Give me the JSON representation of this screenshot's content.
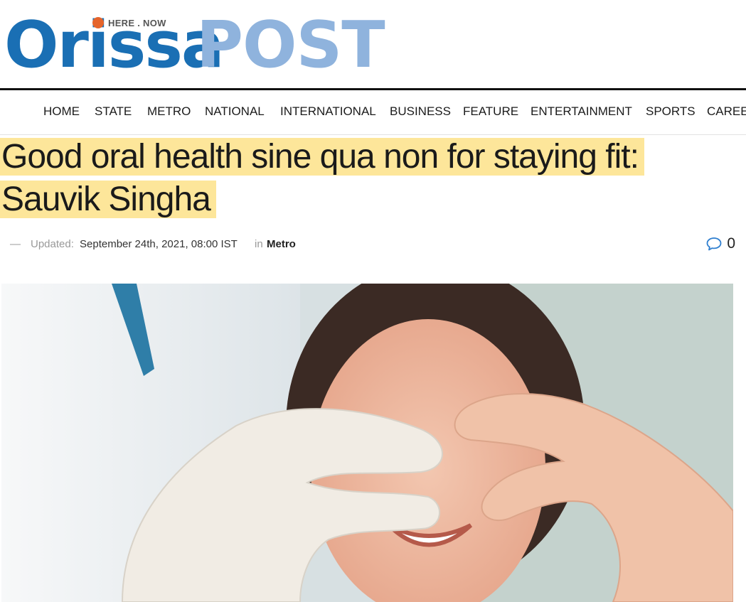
{
  "site": {
    "logo_word1": "Orissa",
    "logo_word2": "POST",
    "tagline": "HERE . NOW",
    "colors": {
      "logo_blue": "#1a6fb4",
      "logo_light_blue": "#8fb3dd",
      "logo_dot": "#e5642b",
      "highlight": "#fde69a"
    }
  },
  "nav": {
    "items": [
      "HOME",
      "STATE",
      "METRO",
      "NATIONAL",
      "INTERNATIONAL",
      "BUSINESS",
      "FEATURE",
      "ENTERTAINMENT",
      "SPORTS",
      "CAREE"
    ]
  },
  "article": {
    "title_line1": "Good oral health sine qua non for staying fit:",
    "title_line2": "Sauvik Singha",
    "meta": {
      "dash": "—",
      "updated_label": "Updated:",
      "date": "September 24th, 2021, 08:00 IST",
      "in_label": "in",
      "category": "Metro",
      "comment_count": "0",
      "comment_icon": "comment-bubble-icon"
    },
    "image_icon": "heart-hands-smile-photo"
  }
}
